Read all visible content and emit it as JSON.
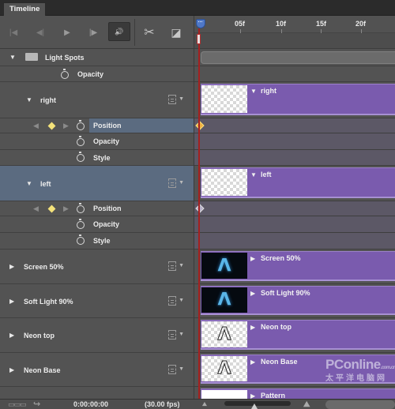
{
  "panel": {
    "tab_label": "Timeline"
  },
  "toolbar": {
    "buttons": [
      {
        "name": "go-to-first-frame",
        "glyph": "|◀"
      },
      {
        "name": "go-to-previous-frame",
        "glyph": "◀|"
      },
      {
        "name": "play",
        "glyph": "▶"
      },
      {
        "name": "go-to-next-frame",
        "glyph": "|▶"
      },
      {
        "name": "toggle-audio",
        "glyph": "🔊"
      },
      {
        "name": "split-at-playhead",
        "glyph": "✂"
      },
      {
        "name": "transitions",
        "glyph": "◪"
      }
    ]
  },
  "ruler": {
    "ticks": [
      "05f",
      "10f",
      "15f",
      "20f"
    ]
  },
  "layers": [
    {
      "id": "light-spots",
      "type": "group",
      "label": "Light Spots",
      "expanded": true
    },
    {
      "id": "light-spots-opacity",
      "type": "property",
      "label": "Opacity"
    },
    {
      "id": "right",
      "type": "layer",
      "label": "right",
      "expanded": true,
      "thumb": "checker",
      "clip_label": "right"
    },
    {
      "id": "right-position",
      "type": "property",
      "label": "Position",
      "keyframe": true,
      "selected": true
    },
    {
      "id": "right-opacity",
      "type": "property",
      "label": "Opacity"
    },
    {
      "id": "right-style",
      "type": "property",
      "label": "Style"
    },
    {
      "id": "left",
      "type": "layer",
      "label": "left",
      "expanded": true,
      "selected": true,
      "thumb": "checker",
      "clip_label": "left"
    },
    {
      "id": "left-position",
      "type": "property",
      "label": "Position",
      "keyframe": true
    },
    {
      "id": "left-opacity",
      "type": "property",
      "label": "Opacity"
    },
    {
      "id": "left-style",
      "type": "property",
      "label": "Style"
    },
    {
      "id": "screen-50",
      "type": "layer",
      "label": "Screen 50%",
      "expanded": false,
      "thumb": "neon",
      "clip_label": "Screen 50%"
    },
    {
      "id": "soft-light-90",
      "type": "layer",
      "label": "Soft Light 90%",
      "expanded": false,
      "thumb": "neon",
      "clip_label": "Soft Light 90%"
    },
    {
      "id": "neon-top",
      "type": "layer",
      "label": "Neon top",
      "expanded": false,
      "thumb": "outline",
      "clip_label": "Neon top"
    },
    {
      "id": "neon-base",
      "type": "layer",
      "label": "Neon Base",
      "expanded": false,
      "thumb": "outline",
      "clip_label": "Neon Base"
    },
    {
      "id": "pattern",
      "type": "layer",
      "label": "Pattern",
      "expanded": false,
      "thumb": "white",
      "clip_label": "Pattern"
    }
  ],
  "footer": {
    "timecode": "0:00:00:00",
    "fps": "(30.00 fps)"
  },
  "watermark": {
    "line1": "PConline",
    "line1_suffix": ".com.cn",
    "line2": "太平洋电脑网"
  },
  "colors": {
    "panel_bg": "#535353",
    "clip_purple": "#7a5bae",
    "selection_blue": "#5b6b80",
    "playhead_red": "#a52020",
    "keyframe_yellow": "#f4e27a"
  }
}
